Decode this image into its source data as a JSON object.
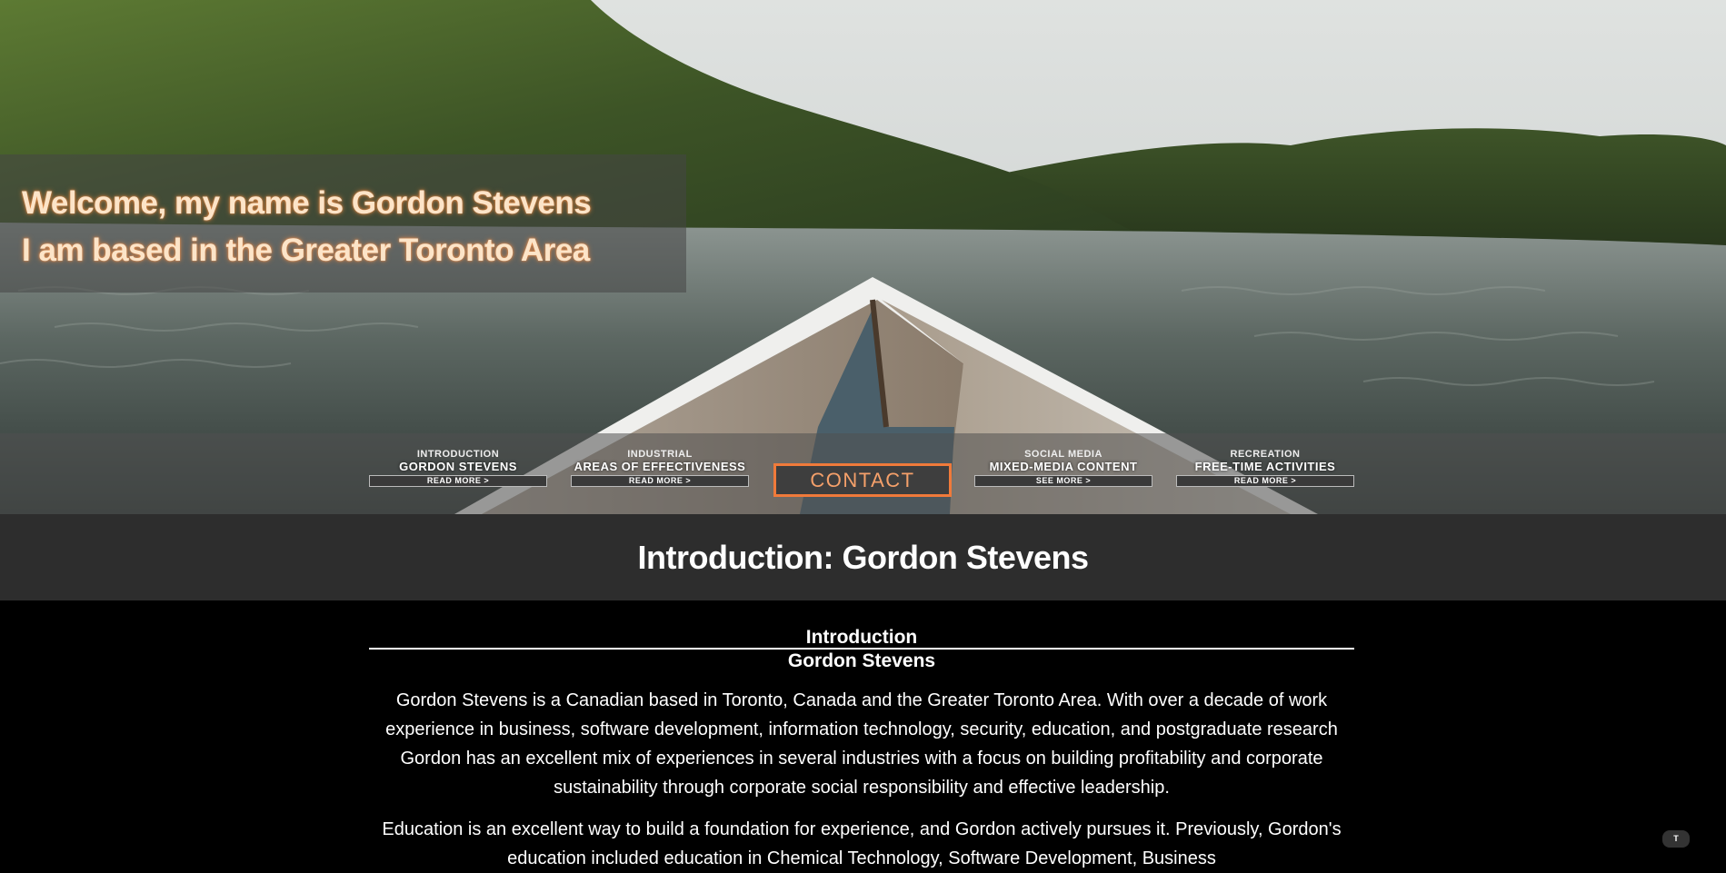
{
  "hero": {
    "welcome_line_1": "Welcome, my name is Gordon Stevens",
    "welcome_line_2": "I am based in the Greater Toronto Area"
  },
  "nav": {
    "items": [
      {
        "kicker": "INTRODUCTION",
        "title": "GORDON STEVENS",
        "more": "READ MORE >"
      },
      {
        "kicker": "INDUSTRIAL",
        "title": "AREAS OF EFFECTIVENESS",
        "more": "READ MORE >"
      },
      {
        "kicker": "SOCIAL MEDIA",
        "title": "MIXED-MEDIA CONTENT",
        "more": "SEE MORE >"
      },
      {
        "kicker": "RECREATION",
        "title": "FREE-TIME ACTIVITIES",
        "more": "READ MORE >"
      }
    ],
    "contact_label": "CONTACT"
  },
  "section": {
    "title": "Introduction: Gordon Stevens"
  },
  "content": {
    "heading": "Introduction",
    "subheading": "Gordon Stevens",
    "paragraph_1": "Gordon Stevens is a Canadian based in Toronto, Canada and the Greater Toronto Area. With over a decade of work experience in business, software development, information technology, security, education, and postgraduate research Gordon has an excellent mix of experiences in several industries with a focus on building profitability and corporate sustainability through corporate social responsibility and effective leadership.",
    "paragraph_2": "Education is an excellent way to build a foundation for experience, and Gordon actively pursues it. Previously, Gordon's education included education in Chemical Technology, Software Development, Business"
  },
  "scroll_top": {
    "label": "T",
    "icon": "arrow-up-icon"
  },
  "colors": {
    "accent": "#f07a3a",
    "title_bar": "#2d2d2d",
    "background": "#000000"
  }
}
